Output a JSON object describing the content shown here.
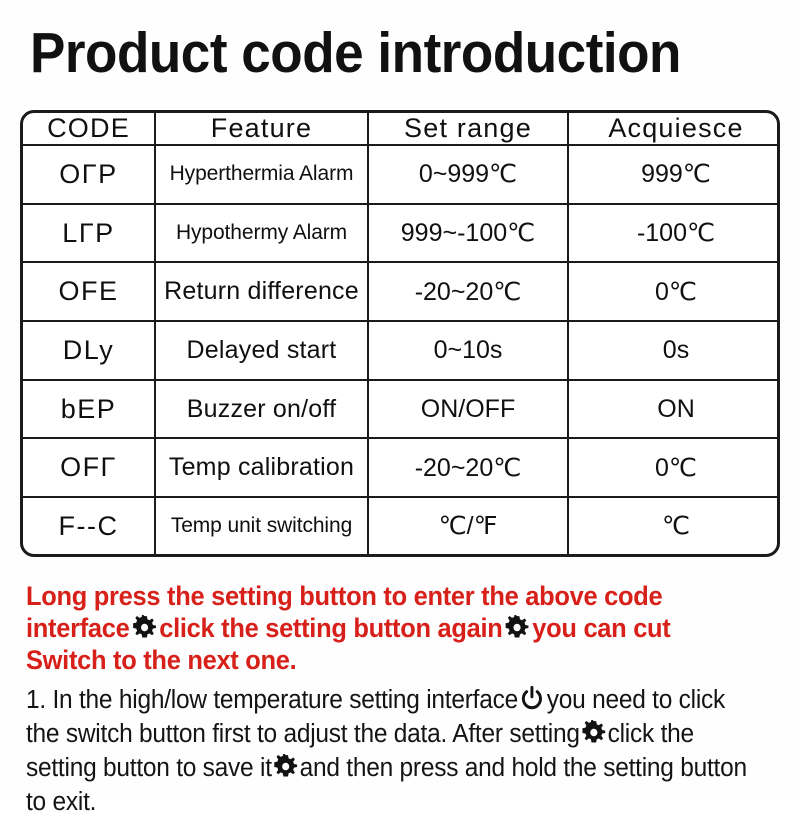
{
  "title": "Product code introduction",
  "table": {
    "headers": [
      "CODE",
      "Feature",
      "Set range",
      "Acquiesce"
    ],
    "rows": [
      {
        "code": "OΓP",
        "feature": "Hyperthermia Alarm",
        "range": "0~999℃",
        "default": "999℃"
      },
      {
        "code": "LΓP",
        "feature": "Hypothermy Alarm",
        "range": "999~-100℃",
        "default": "-100℃"
      },
      {
        "code": "OFE",
        "feature": "Return difference",
        "range": "-20~20℃",
        "default": "0℃"
      },
      {
        "code": "DLy",
        "feature": "Delayed start",
        "range": "0~10s",
        "default": "0s"
      },
      {
        "code": "bEP",
        "feature": "Buzzer on/off",
        "range": "ON/OFF",
        "default": "ON"
      },
      {
        "code": "OFΓ",
        "feature": "Temp calibration",
        "range": "-20~20℃",
        "default": "0℃"
      },
      {
        "code": "F--C",
        "feature": "Temp unit switching",
        "range": "℃/℉",
        "default": "℃"
      }
    ]
  },
  "red_note": {
    "color": "#d8201a",
    "part1": "Long press the setting button to enter the above code interface",
    "icon1": "gear-icon",
    "part2": "click the setting button again",
    "icon2": "gear-icon",
    "part3": "you can cut Switch to the next one."
  },
  "black_note": {
    "color": "#141414",
    "part1": "1. In the high/low temperature setting interface",
    "icon1": "power-icon",
    "part2": "you need to click the switch button first to adjust the data. After setting",
    "icon2": "gear-icon",
    "part3": "click the setting button to save it",
    "icon3": "gear-icon",
    "part4": "and then press and hold the setting button to exit."
  }
}
